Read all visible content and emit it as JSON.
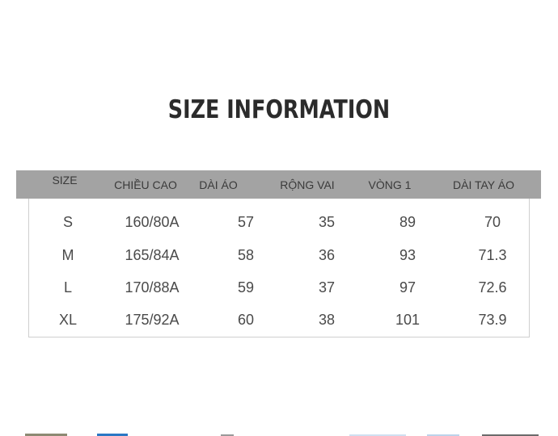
{
  "title": "SIZE INFORMATION",
  "table": {
    "headers": [
      "SIZE",
      "CHIỀU CAO",
      "DÀI ÁO",
      "RỘNG VAI",
      "VÒNG 1",
      "DÀI TAY ÁO"
    ],
    "rows": [
      [
        "S",
        "160/80A",
        "57",
        "35",
        "89",
        "70"
      ],
      [
        "M",
        "165/84A",
        "58",
        "36",
        "93",
        "71.3"
      ],
      [
        "L",
        "170/88A",
        "59",
        "37",
        "97",
        "72.6"
      ],
      [
        "XL",
        "175/92A",
        "60",
        "38",
        "101",
        "73.9"
      ]
    ]
  },
  "colors": {
    "header_background": "#a3a3a3",
    "title_text": "#2b2b2b",
    "cell_text": "#4a4a4a",
    "border": "#cfcfcf"
  }
}
